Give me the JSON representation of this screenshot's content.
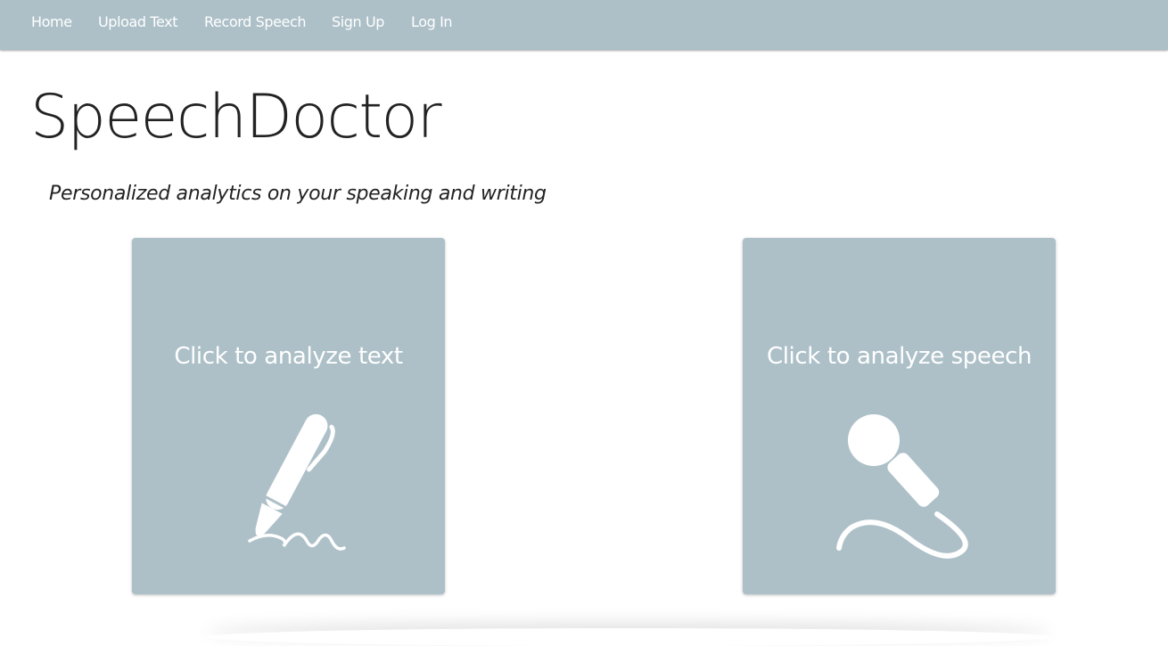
{
  "nav": {
    "items": [
      {
        "label": "Home"
      },
      {
        "label": "Upload Text"
      },
      {
        "label": "Record Speech"
      },
      {
        "label": "Sign Up"
      },
      {
        "label": "Log In"
      }
    ]
  },
  "hero": {
    "title": "SpeechDoctor",
    "tagline": "Personalized analytics on your speaking and writing"
  },
  "cards": [
    {
      "label": "Click to analyze text",
      "icon": "pen-icon"
    },
    {
      "label": "Click to analyze speech",
      "icon": "microphone-icon"
    }
  ],
  "colors": {
    "accent": "#adc0c8",
    "text": "#222222",
    "on_accent": "#ffffff"
  }
}
